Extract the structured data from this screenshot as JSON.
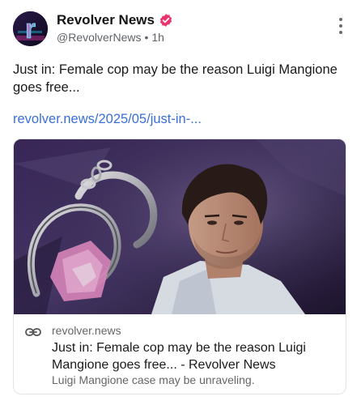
{
  "author": {
    "display_name": "Revolver News",
    "handle": "@RevolverNews",
    "separator": "•",
    "time": "1h",
    "avatar_letter": "r",
    "verified_color": "#e8336b"
  },
  "post": {
    "text": "Just in: Female cop may be the reason Luigi Mangione goes free...",
    "link_text": "revolver.news/2025/05/just-in-..."
  },
  "card": {
    "domain": "revolver.news",
    "title": "Just in: Female cop may be the reason Luigi Mangione goes free... - Revolver News",
    "description": "Luigi Mangione case may be unraveling."
  },
  "colors": {
    "link": "#3a6fd8",
    "muted": "#666666",
    "text": "#1a1a1a"
  },
  "icons": {
    "more": "vertical-ellipsis-icon",
    "link": "chain-link-icon",
    "verified": "verified-badge-icon"
  }
}
